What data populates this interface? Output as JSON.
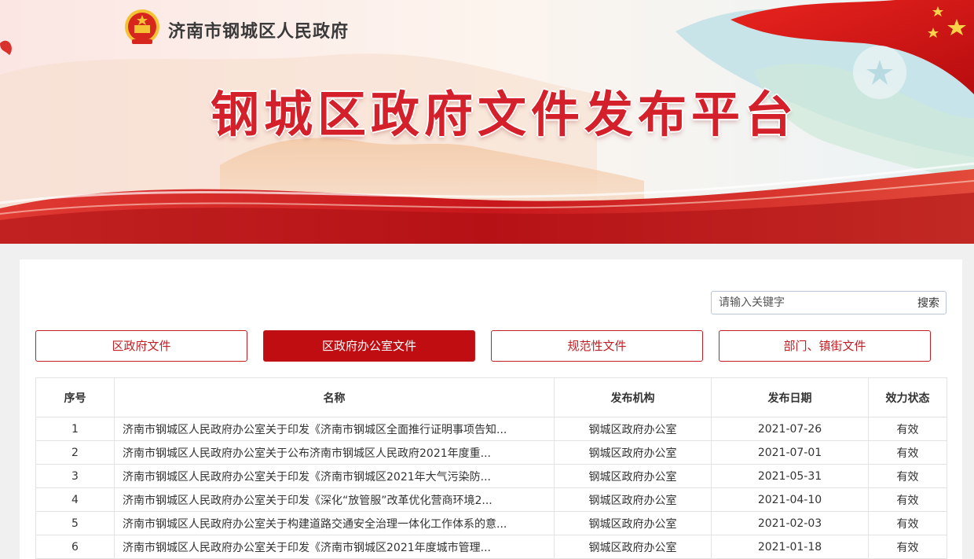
{
  "header": {
    "gov_name": "济南市钢城区人民政府",
    "platform_title": "钢城区政府文件发布平台"
  },
  "search": {
    "placeholder": "请输入关键字",
    "button_label": "搜索"
  },
  "tabs": [
    {
      "label": "区政府文件",
      "active": false
    },
    {
      "label": "区政府办公室文件",
      "active": true
    },
    {
      "label": "规范性文件",
      "active": false
    },
    {
      "label": "部门、镇街文件",
      "active": false
    }
  ],
  "table": {
    "headers": [
      "序号",
      "名称",
      "发布机构",
      "发布日期",
      "效力状态"
    ],
    "rows": [
      {
        "no": "1",
        "title": "济南市钢城区人民政府办公室关于印发《济南市钢城区全面推行证明事项告知...",
        "org": "钢城区政府办公室",
        "date": "2021-07-26",
        "status": "有效"
      },
      {
        "no": "2",
        "title": "济南市钢城区人民政府办公室关于公布济南市钢城区人民政府2021年度重...",
        "org": "钢城区政府办公室",
        "date": "2021-07-01",
        "status": "有效"
      },
      {
        "no": "3",
        "title": "济南市钢城区人民政府办公室关于印发《济南市钢城区2021年大气污染防...",
        "org": "钢城区政府办公室",
        "date": "2021-05-31",
        "status": "有效"
      },
      {
        "no": "4",
        "title": "济南市钢城区人民政府办公室关于印发《深化“放管服”改革优化营商环境2...",
        "org": "钢城区政府办公室",
        "date": "2021-04-10",
        "status": "有效"
      },
      {
        "no": "5",
        "title": "济南市钢城区人民政府办公室关于构建道路交通安全治理一体化工作体系的意...",
        "org": "钢城区政府办公室",
        "date": "2021-02-03",
        "status": "有效"
      },
      {
        "no": "6",
        "title": "济南市钢城区人民政府办公室关于印发《济南市钢城区2021年度城市管理...",
        "org": "钢城区政府办公室",
        "date": "2021-01-18",
        "status": "有效"
      }
    ]
  },
  "colors": {
    "accent_red": "#c00d12",
    "title_red": "#d4202a"
  }
}
